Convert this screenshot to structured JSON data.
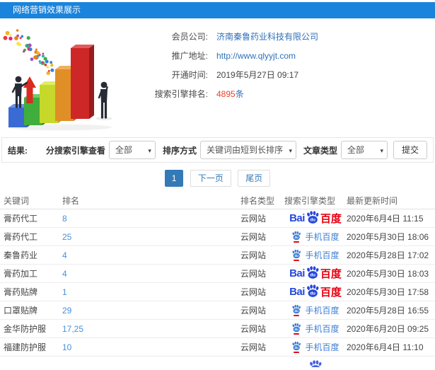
{
  "header": {
    "title": "网络营销效果展示"
  },
  "info": {
    "company_label": "会员公司:",
    "company_value": "济南秦鲁药业科技有限公司",
    "url_label": "推广地址:",
    "url_value": "http://www.qlyyjt.com",
    "open_time_label": "开通时间:",
    "open_time_value": "2019年5月27日 09:17",
    "rank_label": "搜索引擎排名:",
    "rank_count": "4895",
    "rank_unit": "条"
  },
  "filters": {
    "result_label": "结果:",
    "engine_label": "分搜索引擎查看",
    "engine_value": "全部",
    "sort_label": "排序方式",
    "sort_value": "关键词由短到长排序",
    "article_label": "文章类型",
    "article_value": "全部",
    "submit_label": "提交"
  },
  "pagination": {
    "current": "1",
    "next_label": "下一页",
    "last_label": "尾页"
  },
  "table": {
    "headers": [
      "关键词",
      "排名",
      "排名类型",
      "搜索引擎类型",
      "最新更新时间"
    ],
    "engine_labels": {
      "baidu_bai": "Bai",
      "baidu_cn": "百度",
      "mobile_label": "手机百度"
    },
    "rows": [
      {
        "keyword": "膏药代工",
        "rank": "8",
        "rank_type": "云网站",
        "engine": "baidu",
        "time": "2020年6月4日 11:15"
      },
      {
        "keyword": "膏药代工",
        "rank": "25",
        "rank_type": "云网站",
        "engine": "mobile",
        "time": "2020年5月30日 18:06"
      },
      {
        "keyword": "秦鲁药业",
        "rank": "4",
        "rank_type": "云网站",
        "engine": "mobile",
        "time": "2020年5月28日 17:02"
      },
      {
        "keyword": "膏药加工",
        "rank": "4",
        "rank_type": "云网站",
        "engine": "baidu",
        "time": "2020年5月30日 18:03"
      },
      {
        "keyword": "膏药贴牌",
        "rank": "1",
        "rank_type": "云网站",
        "engine": "baidu",
        "time": "2020年5月30日 17:58"
      },
      {
        "keyword": "口罩贴牌",
        "rank": "29",
        "rank_type": "云网站",
        "engine": "mobile",
        "time": "2020年5月28日 16:55"
      },
      {
        "keyword": "金华防护服",
        "rank": "17,25",
        "rank_type": "云网站",
        "engine": "mobile",
        "time": "2020年6月20日 09:25"
      },
      {
        "keyword": "福建防护服",
        "rank": "10",
        "rank_type": "云网站",
        "engine": "mobile",
        "time": "2020年6月4日 11:10"
      }
    ]
  },
  "colors": {
    "header_bg": "#1a84dc",
    "link_blue": "#2f71b8",
    "rank_blue": "#4a90d9",
    "count_red": "#e6442e",
    "baidu_blue": "#2547dc",
    "baidu_red": "#e60012",
    "mobile_blue": "#3f7fd6",
    "pager_active": "#337ab7"
  }
}
